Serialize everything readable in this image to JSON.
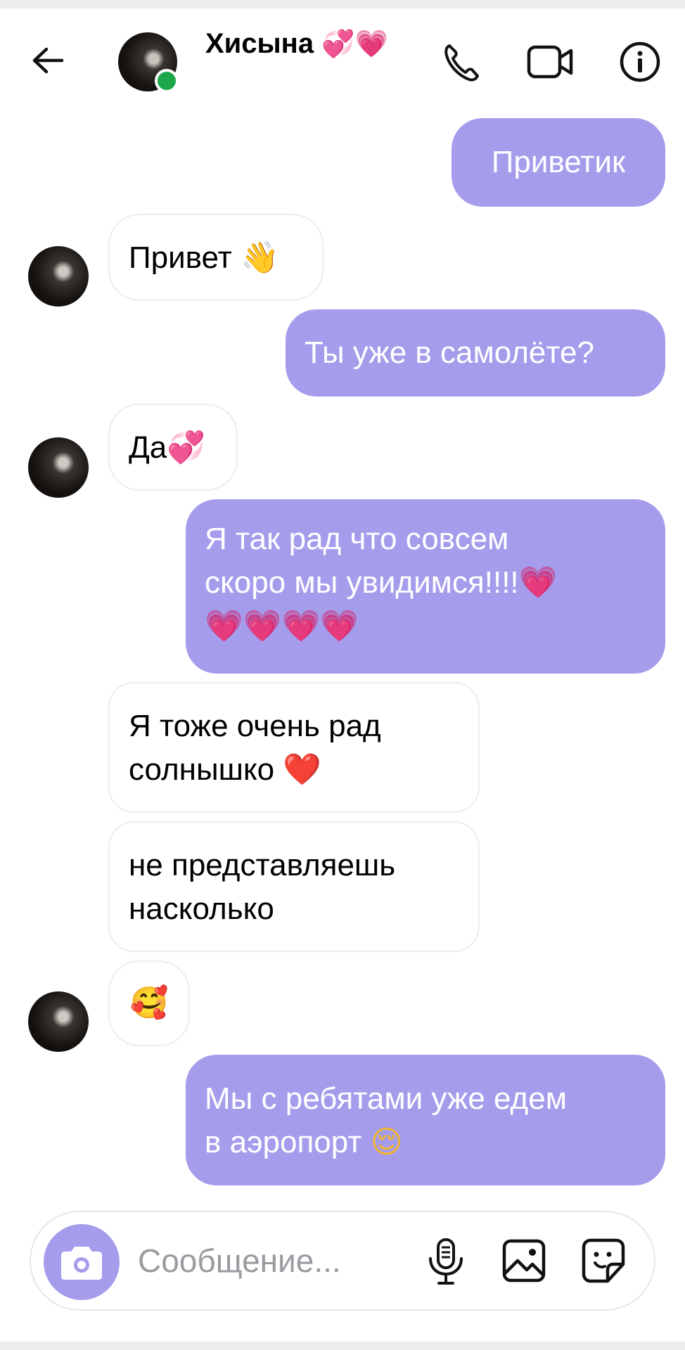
{
  "header": {
    "contact_name": "Хисына",
    "name_emoji": "💞💗",
    "online": true,
    "icons": [
      "back-arrow-icon",
      "phone-icon",
      "video-camera-icon",
      "info-icon"
    ]
  },
  "messages": [
    {
      "side": "out",
      "text": "Приветик"
    },
    {
      "side": "in",
      "text": "Привет",
      "emoji": "👋"
    },
    {
      "side": "out",
      "text": "Ты уже в самолёте?"
    },
    {
      "side": "in",
      "text": "Да",
      "emoji": "💞"
    },
    {
      "side": "out",
      "line1": "Я так рад что совсем",
      "line2": "скоро мы увидимся!!!!",
      "line2_emoji": "💗",
      "line3_emoji": "💗💗💗💗"
    },
    {
      "side": "in",
      "line1": "Я тоже очень рад",
      "line2": "солнышко",
      "emoji": "❤️"
    },
    {
      "side": "in",
      "line1": "не представляешь",
      "line2": "насколько"
    },
    {
      "side": "in",
      "emoji": "🥰"
    },
    {
      "side": "out",
      "line1": "Мы с ребятами уже едем",
      "line2": "в аэропорт",
      "emoji": "😌"
    }
  ],
  "composer": {
    "placeholder": "Сообщение...",
    "icons": [
      "camera-icon",
      "microphone-icon",
      "gallery-icon",
      "sticker-icon"
    ]
  },
  "colors": {
    "outgoing_bubble": "#a59dec",
    "incoming_border": "#ededf1",
    "online_dot": "#1ca64a"
  }
}
